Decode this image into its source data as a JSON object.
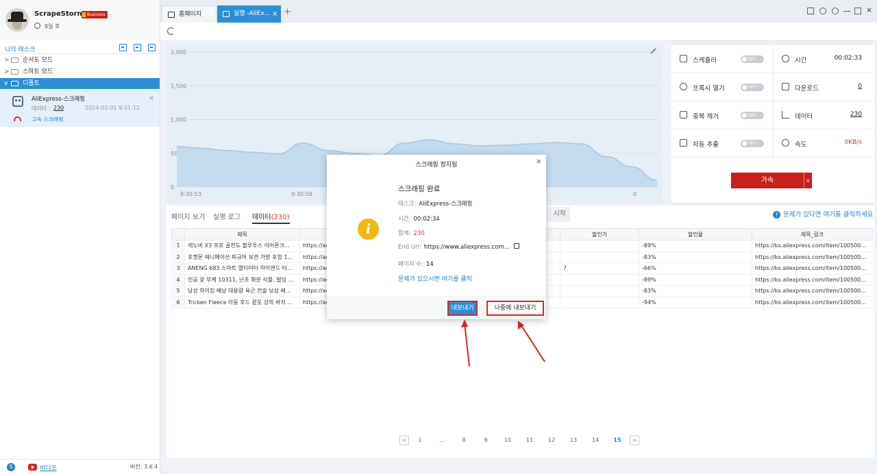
{
  "profile": {
    "app_name": "ScrapeStorm",
    "plan_badge": "Business",
    "expiry": "8일 후"
  },
  "sidebar": {
    "task_title": "나의 태스크",
    "tree": [
      {
        "label": "순서도 모드",
        "active": false
      },
      {
        "label": "스마트 모드",
        "active": false
      },
      {
        "label": "디폴트",
        "active": true
      }
    ],
    "task": {
      "name": "AliExpress-스크래핑",
      "data_label": "데이터 :",
      "data_value": "230",
      "datetime": "2024-02-01 9:31:12",
      "mode": "고속 스크래핑"
    },
    "footer": {
      "video_link": "비디오",
      "version": "버전: 3.6.4"
    }
  },
  "tabs": [
    {
      "label": "홈페이지",
      "active": false
    },
    {
      "label": "실행 -AliEx...",
      "active": true
    }
  ],
  "chart_data": {
    "type": "area",
    "title": "",
    "xlabel": "",
    "ylabel": "",
    "ylim": [
      0,
      2000
    ],
    "y_ticks": [
      "0",
      "500",
      "1,000",
      "1,500",
      "2,000"
    ],
    "x_ticks": [
      "9:30:53",
      "9:30:58",
      "0"
    ],
    "series": [
      {
        "values": [
          600,
          575,
          540,
          515,
          490,
          650,
          540,
          500,
          470,
          650,
          700,
          640,
          610,
          620,
          640,
          660,
          640,
          450,
          300,
          100
        ]
      }
    ]
  },
  "stats": {
    "scheduler": {
      "label": "스케쥴러",
      "toggle": "OFF"
    },
    "time": {
      "label": "시간",
      "value": "00:02:33"
    },
    "proxy": {
      "label": "프록시 열기",
      "toggle": "OFF"
    },
    "download": {
      "label": "다운로드",
      "value": "0"
    },
    "dedup": {
      "label": "중복 제거",
      "toggle": "OFF"
    },
    "data": {
      "label": "데이터",
      "value": "230"
    },
    "auto_extract": {
      "label": "자동 추출",
      "toggle": "OFF"
    },
    "speed": {
      "label": "속도",
      "value": "0KB/s"
    },
    "accel_button": "가속"
  },
  "data_area": {
    "subtabs": [
      "페이지 보기",
      "실행 로그"
    ],
    "data_tab": "데이터",
    "data_count": "(230)",
    "start_button": "시작",
    "help_link": "문제가 있다면 여기를 클릭하세요",
    "columns": [
      "제목",
      "할인가",
      "할인율",
      "제목_링크"
    ],
    "rows": [
      {
        "n": "1",
        "title": "레노버 X3 프로 골전도 블루투스 이어폰크...",
        "link": "https://ae0",
        "price": "",
        "rate": "-89%",
        "url": "https://ko.aliexpress.com/item/1005004995..."
      },
      {
        "n": "2",
        "title": "포켓몬 애니메이션 피규어 보관 가방 포함 1...",
        "link": "https://ae0",
        "price": "",
        "rate": "-83%",
        "url": "https://ko.aliexpress.com/item/1005005759..."
      },
      {
        "n": "3",
        "title": "ANENG 683 스마트 멀티미터 하이엔드 터치...",
        "link": "https://ae0",
        "price": "7",
        "rate": "-66%",
        "url": "https://ko.aliexpress.com/item/1005005702..."
      },
      {
        "n": "4",
        "title": "인공 꽃 부케 10311, 난초 화분 식물, 빌딩 블...",
        "link": "https://ae0",
        "price": "",
        "rate": "-89%",
        "url": "https://ko.aliexpress.com/item/1005005663..."
      },
      {
        "n": "5",
        "title": "남성 하이킹 배낭 대용량 육군 전술 남성 배...",
        "link": "https://ae0",
        "price": "",
        "rate": "-83%",
        "url": "https://ko.aliexpress.com/item/1005005358..."
      },
      {
        "n": "6",
        "title": "Tricken Fleece 아동 후드 겉옷 상의 바지 세...",
        "link": "https://ae0",
        "price": "",
        "rate": "-94%",
        "url": "https://ko.aliexpress.com/item/1005005070..."
      }
    ],
    "pages": [
      "1",
      "...",
      "8",
      "9",
      "10",
      "11",
      "12",
      "13",
      "14",
      "15"
    ],
    "current_page": "15"
  },
  "dialog": {
    "title": "스크래핑 정지됨",
    "heading": "스크래핑 완료",
    "task_label": "태스크:",
    "task_value": "AliExpress-스크래핑",
    "time_label": "시간:",
    "time_value": "00:02:34",
    "total_label": "합계:",
    "total_value": "230",
    "end_url_label": "End Url:",
    "end_url_value": "https://www.aliexpress.com...",
    "pages_label": "페이지 수:",
    "pages_value": "14",
    "help": "문제가 있으시면 여기를 클릭",
    "export_button": "내보내기",
    "later_button": "나중에 내보내기"
  },
  "colors": {
    "accent": "#2b8fd6",
    "danger": "#c8201b",
    "info": "#f2b711"
  }
}
